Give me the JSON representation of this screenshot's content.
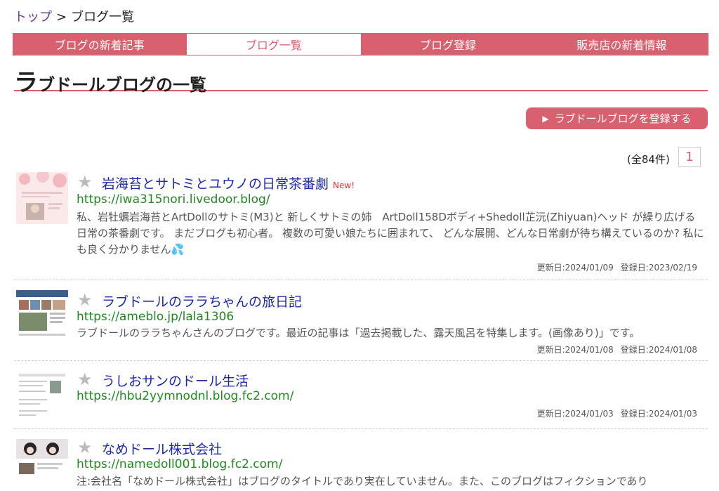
{
  "breadcrumb": {
    "home": "トップ",
    "separator": ">",
    "current": "ブログ一覧"
  },
  "tabs": [
    {
      "label": "ブログの新着記事",
      "active": false
    },
    {
      "label": "ブログ一覧",
      "active": true
    },
    {
      "label": "ブログ登録",
      "active": false
    },
    {
      "label": "販売店の新着情報",
      "active": false
    }
  ],
  "page_title": {
    "first_char": "ラ",
    "rest": "ブドールブログの一覧"
  },
  "register_button": {
    "label": "ラブドールブログを登録する"
  },
  "pagination": {
    "count_text": "(全84件)",
    "current_page": "1"
  },
  "entries": [
    {
      "title": "岩海苔とサトミとユウノの日常茶番劇",
      "badge": "New!",
      "url": "https://iwa315nori.livedoor.blog/",
      "description": "私、岩牡蠣岩海苔とArtDollのサトミ(M3)と 新しくサトミの姉　ArtDoll158Dボディ+Shedoll芷沅(Zhiyuan)ヘッド が繰り広げる日常の茶番劇です。 まだブログも初心者。 複数の可愛い娘たちに囲まれて、 どんな展開、どんな日常劇が待ち構えているのか? 私にも良く分かりません💦",
      "updated": "更新日:2024/01/09",
      "registered": "登録日:2023/02/19"
    },
    {
      "title": "ラブドールのララちゃんの旅日記",
      "badge": "",
      "url": "https://ameblo.jp/lala1306",
      "description": "ラブドールのララちゃんさんのブログです。最近の記事は「過去掲載した、露天風呂を特集します。(画像あり)」です。",
      "updated": "更新日:2024/01/08",
      "registered": "登録日:2024/01/08"
    },
    {
      "title": "うしおサンのドール生活",
      "badge": "",
      "url": "https://hbu2yymnodnl.blog.fc2.com/",
      "description": "",
      "updated": "更新日:2024/01/03",
      "registered": "登録日:2024/01/03"
    },
    {
      "title": "なめドール株式会社",
      "badge": "",
      "url": "https://namedoll001.blog.fc2.com/",
      "description": "注:会社名「なめドール株式会社」はブログのタイトルであり実在していません。また、このブログはフィクションであり",
      "updated": "",
      "registered": ""
    }
  ],
  "colors": {
    "accent": "#d9606e",
    "link": "#1d28b0",
    "url": "#1e8a1e",
    "badge": "#ee3333"
  },
  "icons": {
    "star": "star-icon",
    "play": "play-triangle-icon"
  }
}
